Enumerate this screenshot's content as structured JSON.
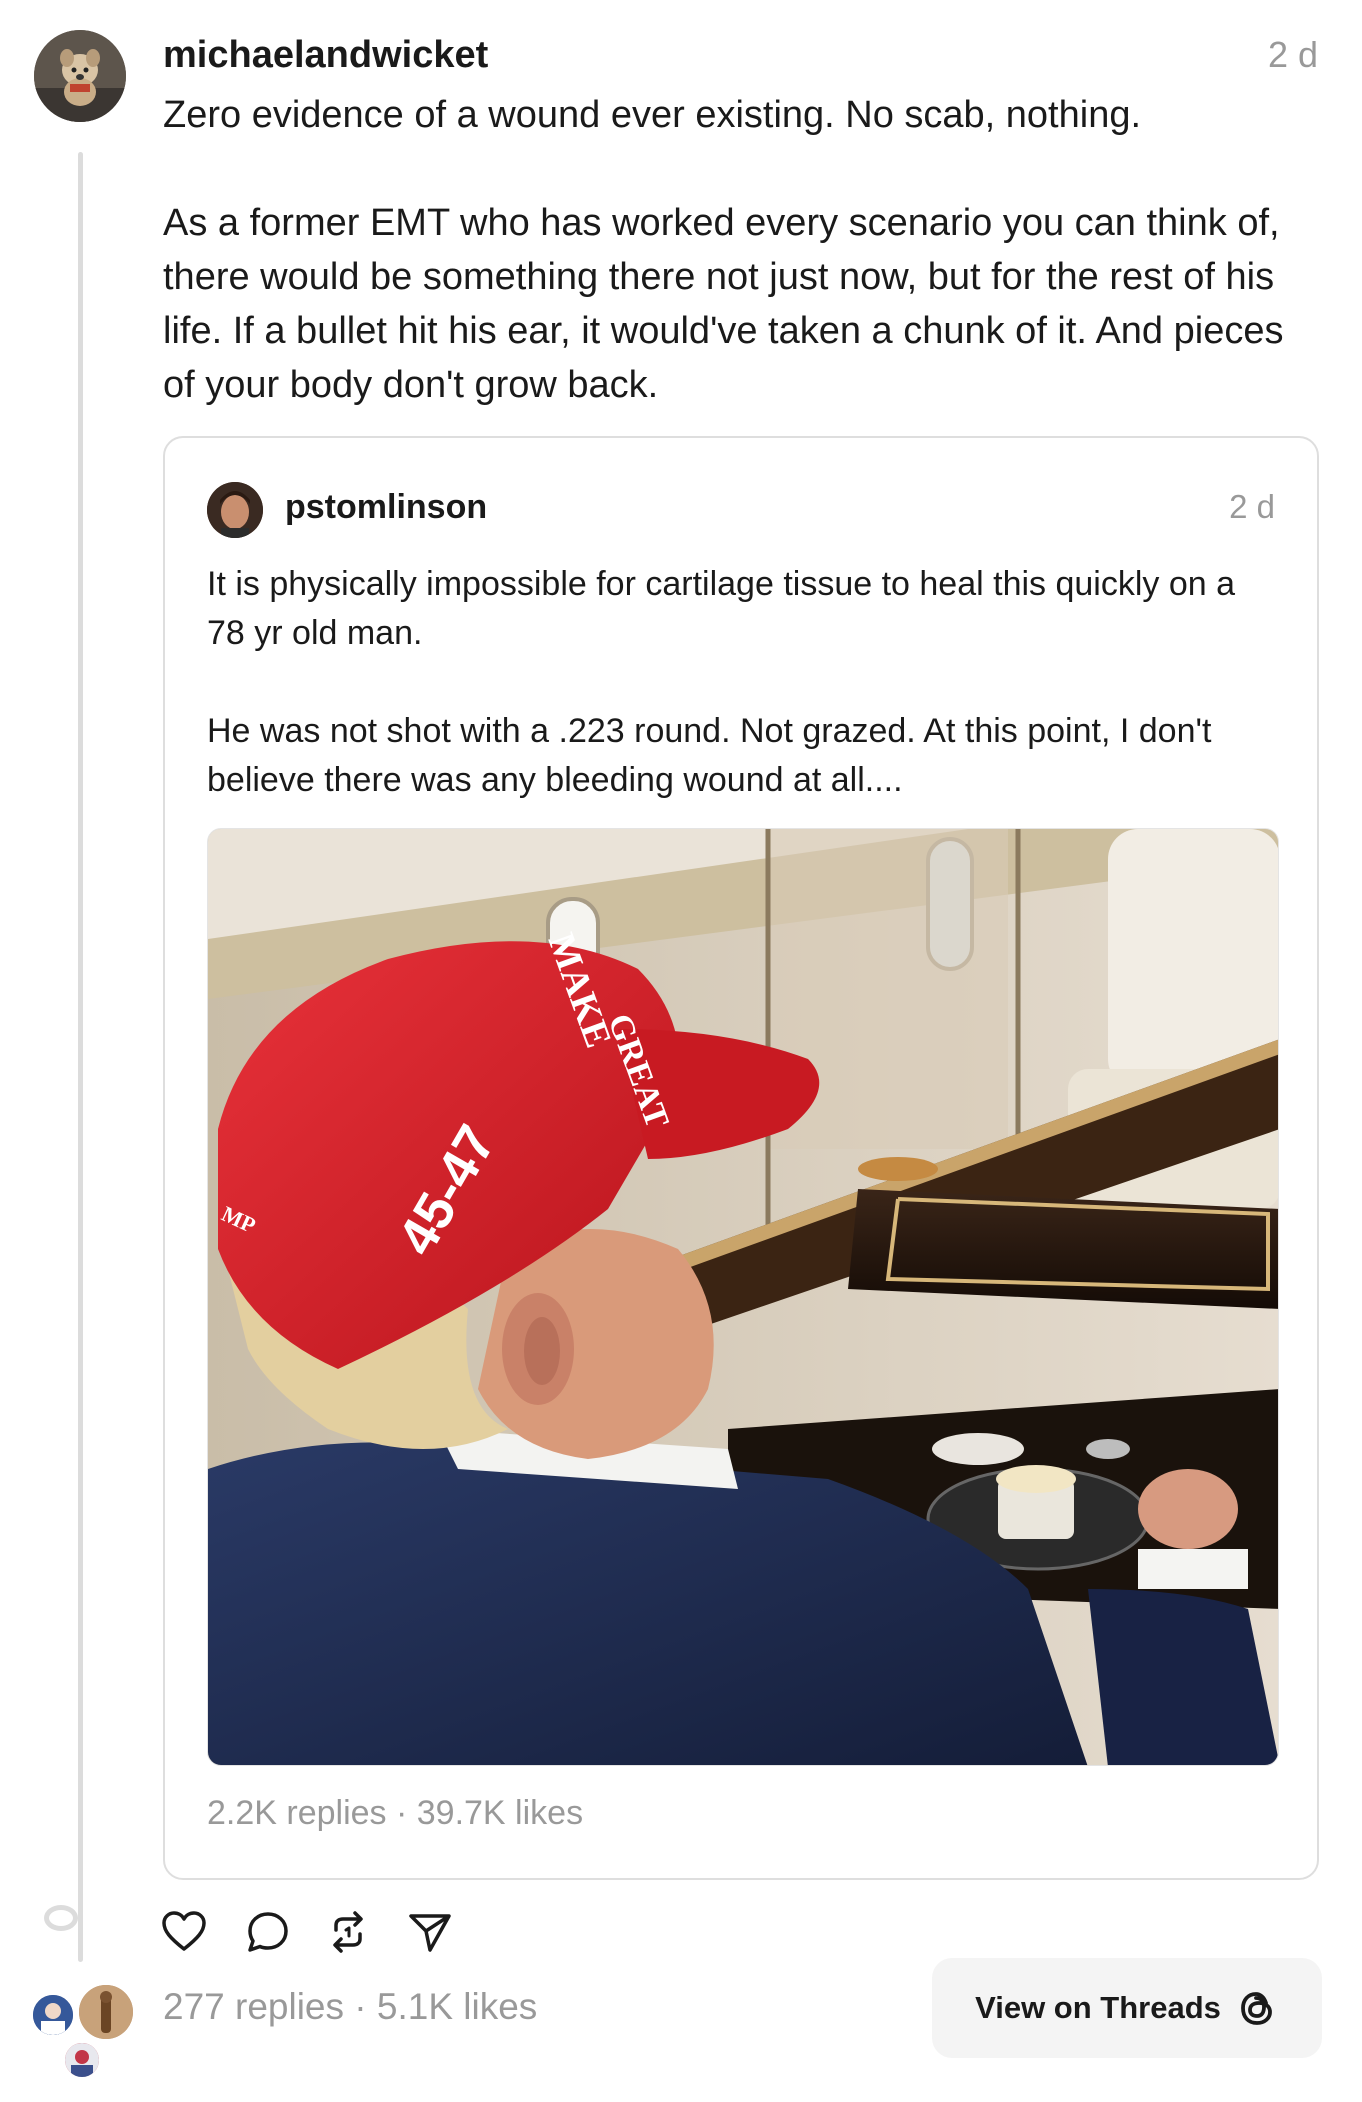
{
  "post": {
    "username": "michaelandwicket",
    "timestamp": "2 d",
    "paragraphs": [
      "Zero evidence of a wound ever existing. No scab, nothing.",
      "As a former EMT who has worked every scenario you can think of, there would be something there not just now, but for the rest of his life. If a bullet hit his ear, it would've taken a chunk of it. And pieces of your body don't grow back."
    ],
    "stats": "277 replies · 5.1K likes"
  },
  "quoted_post": {
    "username": "pstomlinson",
    "timestamp": "2 d",
    "paragraphs": [
      "It is physically impossible for cartilage tissue to heal this quickly on a 78 yr old man.",
      "He was not shot with a .223 round. Not grazed. At this point, I don't believe there was any bleeding wound at all...."
    ],
    "image": {
      "hat_text_front": "MAKE",
      "hat_text_front2": "GREAT",
      "hat_text_side": "45-47",
      "hat_text_back": "MP"
    },
    "stats": "2.2K replies · 39.7K likes"
  },
  "actions": {
    "icons": [
      "heart-icon",
      "comment-icon",
      "repost-icon",
      "share-icon"
    ]
  },
  "view_button": {
    "label": "View on Threads"
  },
  "colors": {
    "text": "#1a1a1a",
    "muted": "#999999",
    "border": "#dedede",
    "hat_red": "#d81f26",
    "jacket_navy": "#1d2a4a"
  }
}
